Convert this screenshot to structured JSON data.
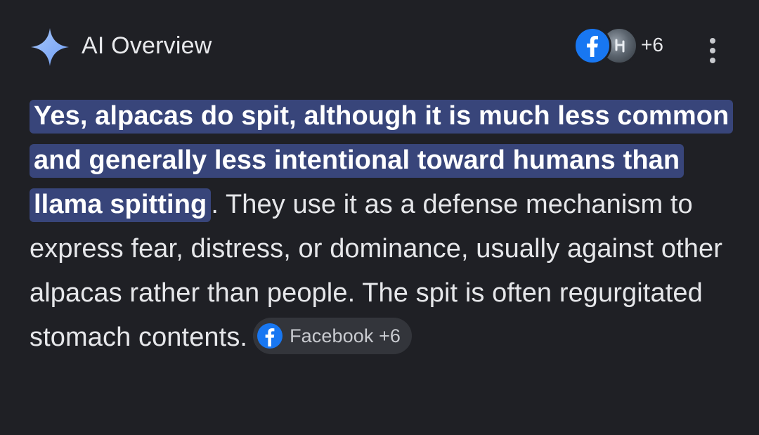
{
  "header": {
    "title": "AI Overview",
    "sparkle_icon": "sparkle-icon",
    "sources_count": "+6",
    "source_icons": [
      "facebook-icon",
      "source-favicon-icon"
    ],
    "more_icon": "more-vert-icon"
  },
  "answer": {
    "highlight": "Yes, alpacas do spit, although it is much less common and generally less intentional toward humans than llama spitting",
    "rest": ". They use it as a defense mechanism to express fear, distress, or dominance, usually against other alpacas rather than people. The spit is often regurgitated stomach contents.",
    "citation_chip": {
      "label": "Facebook +6",
      "icon": "facebook-icon"
    }
  },
  "colors": {
    "background": "#1f2025",
    "highlight": "#38457a",
    "accent_sparkle": "#8ab4f8",
    "facebook": "#1877f2",
    "chip": "#33353b"
  }
}
